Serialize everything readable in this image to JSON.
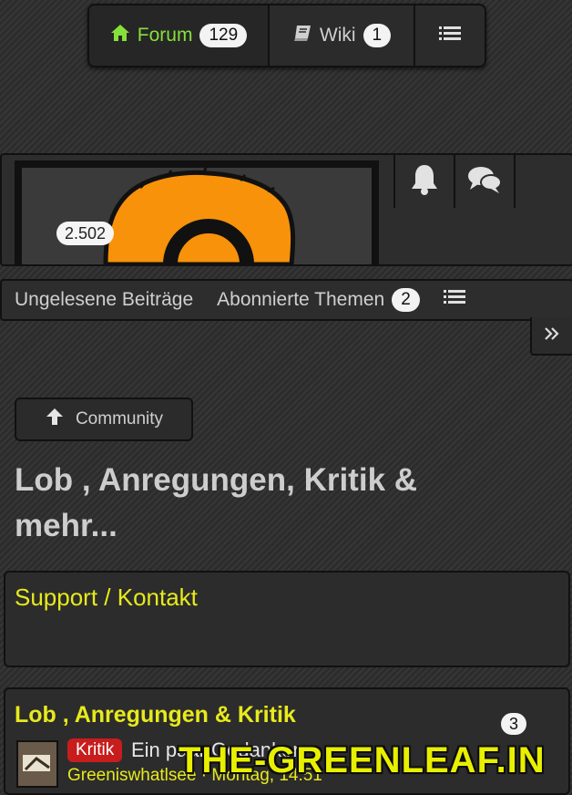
{
  "topnav": {
    "forum_label": "Forum",
    "forum_count": "129",
    "wiki_label": "Wiki",
    "wiki_count": "1",
    "accent_color": "#86e03a"
  },
  "header": {
    "user_count_badge": "2.502",
    "icons": [
      "bell-icon",
      "chat-bubbles-icon"
    ]
  },
  "subnav": {
    "unread_label": "Ungelesene Beiträge",
    "subscribed_label": "Abonnierte Themen",
    "subscribed_count": "2"
  },
  "breadcrumb": {
    "back_label": "Community"
  },
  "page": {
    "title": "Lob , Anregungen, Kritik & mehr..."
  },
  "cards": {
    "support_title": "Support / Kontakt",
    "lob_title": "Lob , Anregungen & Kritik",
    "lob_count": "3"
  },
  "thread": {
    "tag": "Kritik",
    "title": "Ein paar Gedanken",
    "author_line": "Greeniswhatlsee · Montag, 14:51"
  },
  "watermark": "THE-GREENLEAF.IN",
  "colors": {
    "title_yellow": "#e7ea1c",
    "tag_red": "#c81d1d",
    "logo_orange": "#f7920a"
  }
}
